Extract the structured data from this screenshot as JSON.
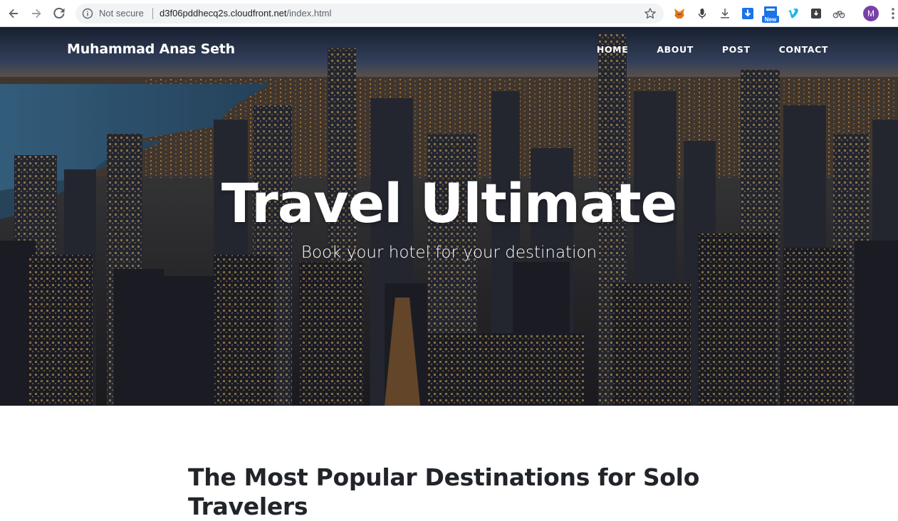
{
  "browser": {
    "security_label": "Not secure",
    "url_host": "d3f06pddhecq2s.cloudfront.net",
    "url_path": "/index.html",
    "extensions": [
      "metamask-fox-icon",
      "microphone-icon",
      "download-icon",
      "download-arrow-icon",
      "new-badge-icon",
      "vimeo-icon",
      "save-icon",
      "cyclist-icon"
    ],
    "new_badge": "New",
    "profile_initial": "M"
  },
  "site": {
    "brand": "Muhammad Anas Seth",
    "nav": [
      {
        "label": "HOME"
      },
      {
        "label": "ABOUT"
      },
      {
        "label": "POST"
      },
      {
        "label": "CONTACT"
      }
    ]
  },
  "hero": {
    "title": "Travel Ultimate",
    "subtitle": "Book your hotel for your destination"
  },
  "content": {
    "post_title": "The Most Popular Destinations for Solo Travelers"
  }
}
